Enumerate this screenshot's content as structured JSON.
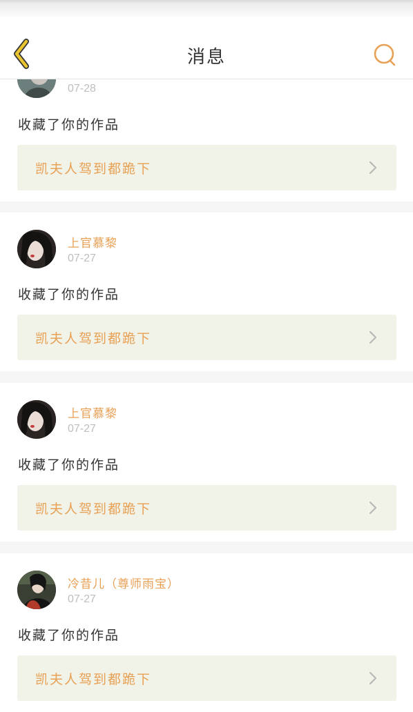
{
  "header": {
    "title": "消息",
    "back_icon": "chevron-left-icon",
    "search_icon": "search-icon"
  },
  "colors": {
    "accent": "#e8a055",
    "back_icon": "#e8c430",
    "card_link_bg": "#f1f3e8"
  },
  "messages": [
    {
      "username": "",
      "date": "07-28",
      "action": "收藏了你的作品",
      "work_title": "凯夫人驾到都跪下"
    },
    {
      "username": "上官慕黎",
      "date": "07-27",
      "action": "收藏了你的作品",
      "work_title": "凯夫人驾到都跪下"
    },
    {
      "username": "上官慕黎",
      "date": "07-27",
      "action": "收藏了你的作品",
      "work_title": "凯夫人驾到都跪下"
    },
    {
      "username": "冷昔儿（尊师雨宝）",
      "date": "07-27",
      "action": "收藏了你的作品",
      "work_title": "凯夫人驾到都跪下"
    }
  ]
}
